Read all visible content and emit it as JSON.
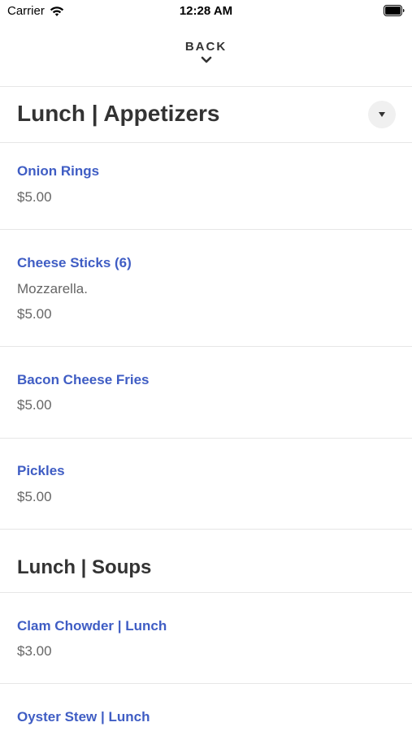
{
  "status_bar": {
    "carrier": "Carrier",
    "time": "12:28 AM"
  },
  "nav": {
    "back_label": "BACK"
  },
  "sections": [
    {
      "title": "Lunch | Appetizers",
      "items": [
        {
          "name": "Onion Rings",
          "price": "$5.00"
        },
        {
          "name": "Cheese Sticks (6)",
          "description": "Mozzarella.",
          "price": "$5.00"
        },
        {
          "name": "Bacon Cheese Fries",
          "price": "$5.00"
        },
        {
          "name": "Pickles",
          "price": "$5.00"
        }
      ]
    },
    {
      "title": "Lunch | Soups",
      "items": [
        {
          "name": "Clam Chowder | Lunch",
          "price": "$3.00"
        },
        {
          "name": "Oyster Stew | Lunch"
        }
      ]
    }
  ],
  "colors": {
    "item_name": "#3f5dc4",
    "text_secondary": "#666666",
    "heading": "#333333",
    "divider": "#e6e6e6"
  },
  "icons": [
    "wifi-icon",
    "battery-icon",
    "chevron-down-icon",
    "caret-down-icon"
  ]
}
